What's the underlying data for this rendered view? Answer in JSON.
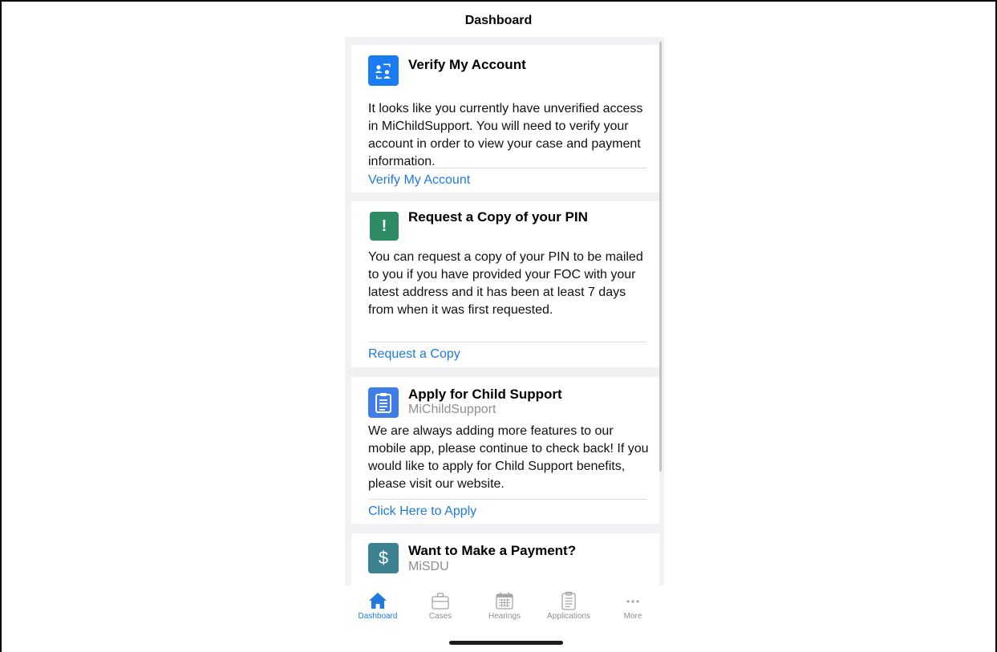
{
  "header": {
    "title": "Dashboard"
  },
  "cards": [
    {
      "icon": "verify-account-icon",
      "icon_color": "#1a7cf2",
      "title": "Verify My Account",
      "body": "It looks like you currently have unverified access in MiChildSupport.  You will need to verify your account in order to view your case and payment information.",
      "link": "Verify My Account"
    },
    {
      "icon": "exclamation-icon",
      "icon_color": "#2e8b63",
      "title": "Request a Copy of your PIN",
      "body": "You can request a copy of your PIN to be mailed to you if you have provided your FOC with your latest address and it has been at least 7 days from when it was first requested.",
      "link": "Request a Copy"
    },
    {
      "icon": "clipboard-icon",
      "icon_color": "#3f7de8",
      "title": "Apply for Child Support",
      "subtitle": "MiChildSupport",
      "body": "We are always adding more features to our mobile app, please continue to check back! If you would like to apply for Child Support benefits, please visit our website.",
      "link": "Click Here to Apply"
    },
    {
      "icon": "dollar-icon",
      "icon_color": "#3d8291",
      "title": "Want to Make a Payment?",
      "subtitle": "MiSDU"
    }
  ],
  "tabbar": {
    "items": [
      {
        "label": "Dashboard",
        "icon": "home-icon",
        "active": true
      },
      {
        "label": "Cases",
        "icon": "briefcase-icon",
        "active": false
      },
      {
        "label": "Hearings",
        "icon": "calendar-icon",
        "active": false
      },
      {
        "label": "Applications",
        "icon": "clipboard-icon",
        "active": false
      },
      {
        "label": "More",
        "icon": "more-dots-icon",
        "active": false
      }
    ]
  },
  "colors": {
    "accent": "#1f7ae0",
    "inactive": "#8e8e93",
    "feed_bg": "#f2f2f4"
  }
}
